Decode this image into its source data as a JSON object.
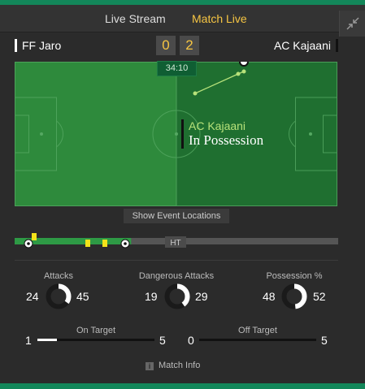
{
  "tabs": [
    {
      "label": "Live Stream"
    },
    {
      "label": "Match Live"
    }
  ],
  "match": {
    "home_team": "FF Jaro",
    "away_team": "AC Kajaani",
    "home_score": "0",
    "away_score": "2",
    "clock": "34:10",
    "possession_team": "AC Kajaani",
    "possession_label": "In Possession",
    "show_events_label": "Show Event Locations",
    "half_time_marker": "HT",
    "timeline_progress": 0.36
  },
  "stats": {
    "attacks": {
      "title": "Attacks",
      "home": "24",
      "away": "45"
    },
    "dangerous": {
      "title": "Dangerous Attacks",
      "home": "19",
      "away": "29"
    },
    "possession": {
      "title": "Possession %",
      "home": "48",
      "away": "52"
    },
    "on_target": {
      "title": "On Target",
      "home": "1",
      "away": "5"
    },
    "off_target": {
      "title": "Off Target",
      "home": "0",
      "away": "5"
    }
  },
  "footer": {
    "match_info_label": "Match Info"
  },
  "colors": {
    "accent": "#13875a",
    "highlight": "#f6c543",
    "pitch_home": "#2e8a3c",
    "pitch_away": "#1f6f30",
    "possession_team": "#b7e27a"
  },
  "icons": {
    "collapse": "collapse-arrows-icon",
    "info": "info-icon",
    "goal": "football-icon",
    "card": "yellow-card-icon"
  }
}
